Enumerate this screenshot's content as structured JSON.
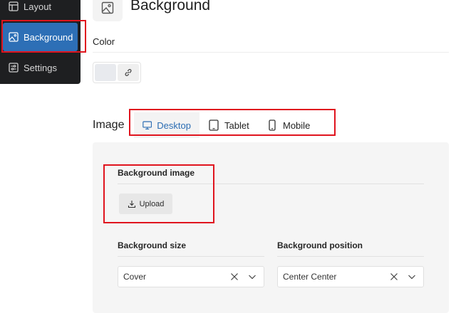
{
  "sidebar": {
    "items": [
      {
        "label": "Layout",
        "icon": "layout-icon"
      },
      {
        "label": "Background",
        "icon": "background-image-icon",
        "active": true
      },
      {
        "label": "Settings",
        "icon": "sliders-icon"
      }
    ],
    "bg_color": "#1e1f21",
    "active_color": "#2d6fb6"
  },
  "header": {
    "title": "Background",
    "icon": "image-icon"
  },
  "color": {
    "label": "Color",
    "swatch_color": "#e8eaee",
    "link_icon": "link-icon"
  },
  "image": {
    "label": "Image",
    "tabs": [
      {
        "label": "Desktop",
        "icon": "desktop-icon",
        "active": true
      },
      {
        "label": "Tablet",
        "icon": "tablet-icon"
      },
      {
        "label": "Mobile",
        "icon": "mobile-icon"
      }
    ],
    "accent_color": "#2b6db3"
  },
  "panel": {
    "bg_image_label": "Background image",
    "upload_label": "Upload",
    "size": {
      "label": "Background size",
      "value": "Cover"
    },
    "position": {
      "label": "Background position",
      "value": "Center Center"
    }
  },
  "highlight_color": "#e0141e"
}
